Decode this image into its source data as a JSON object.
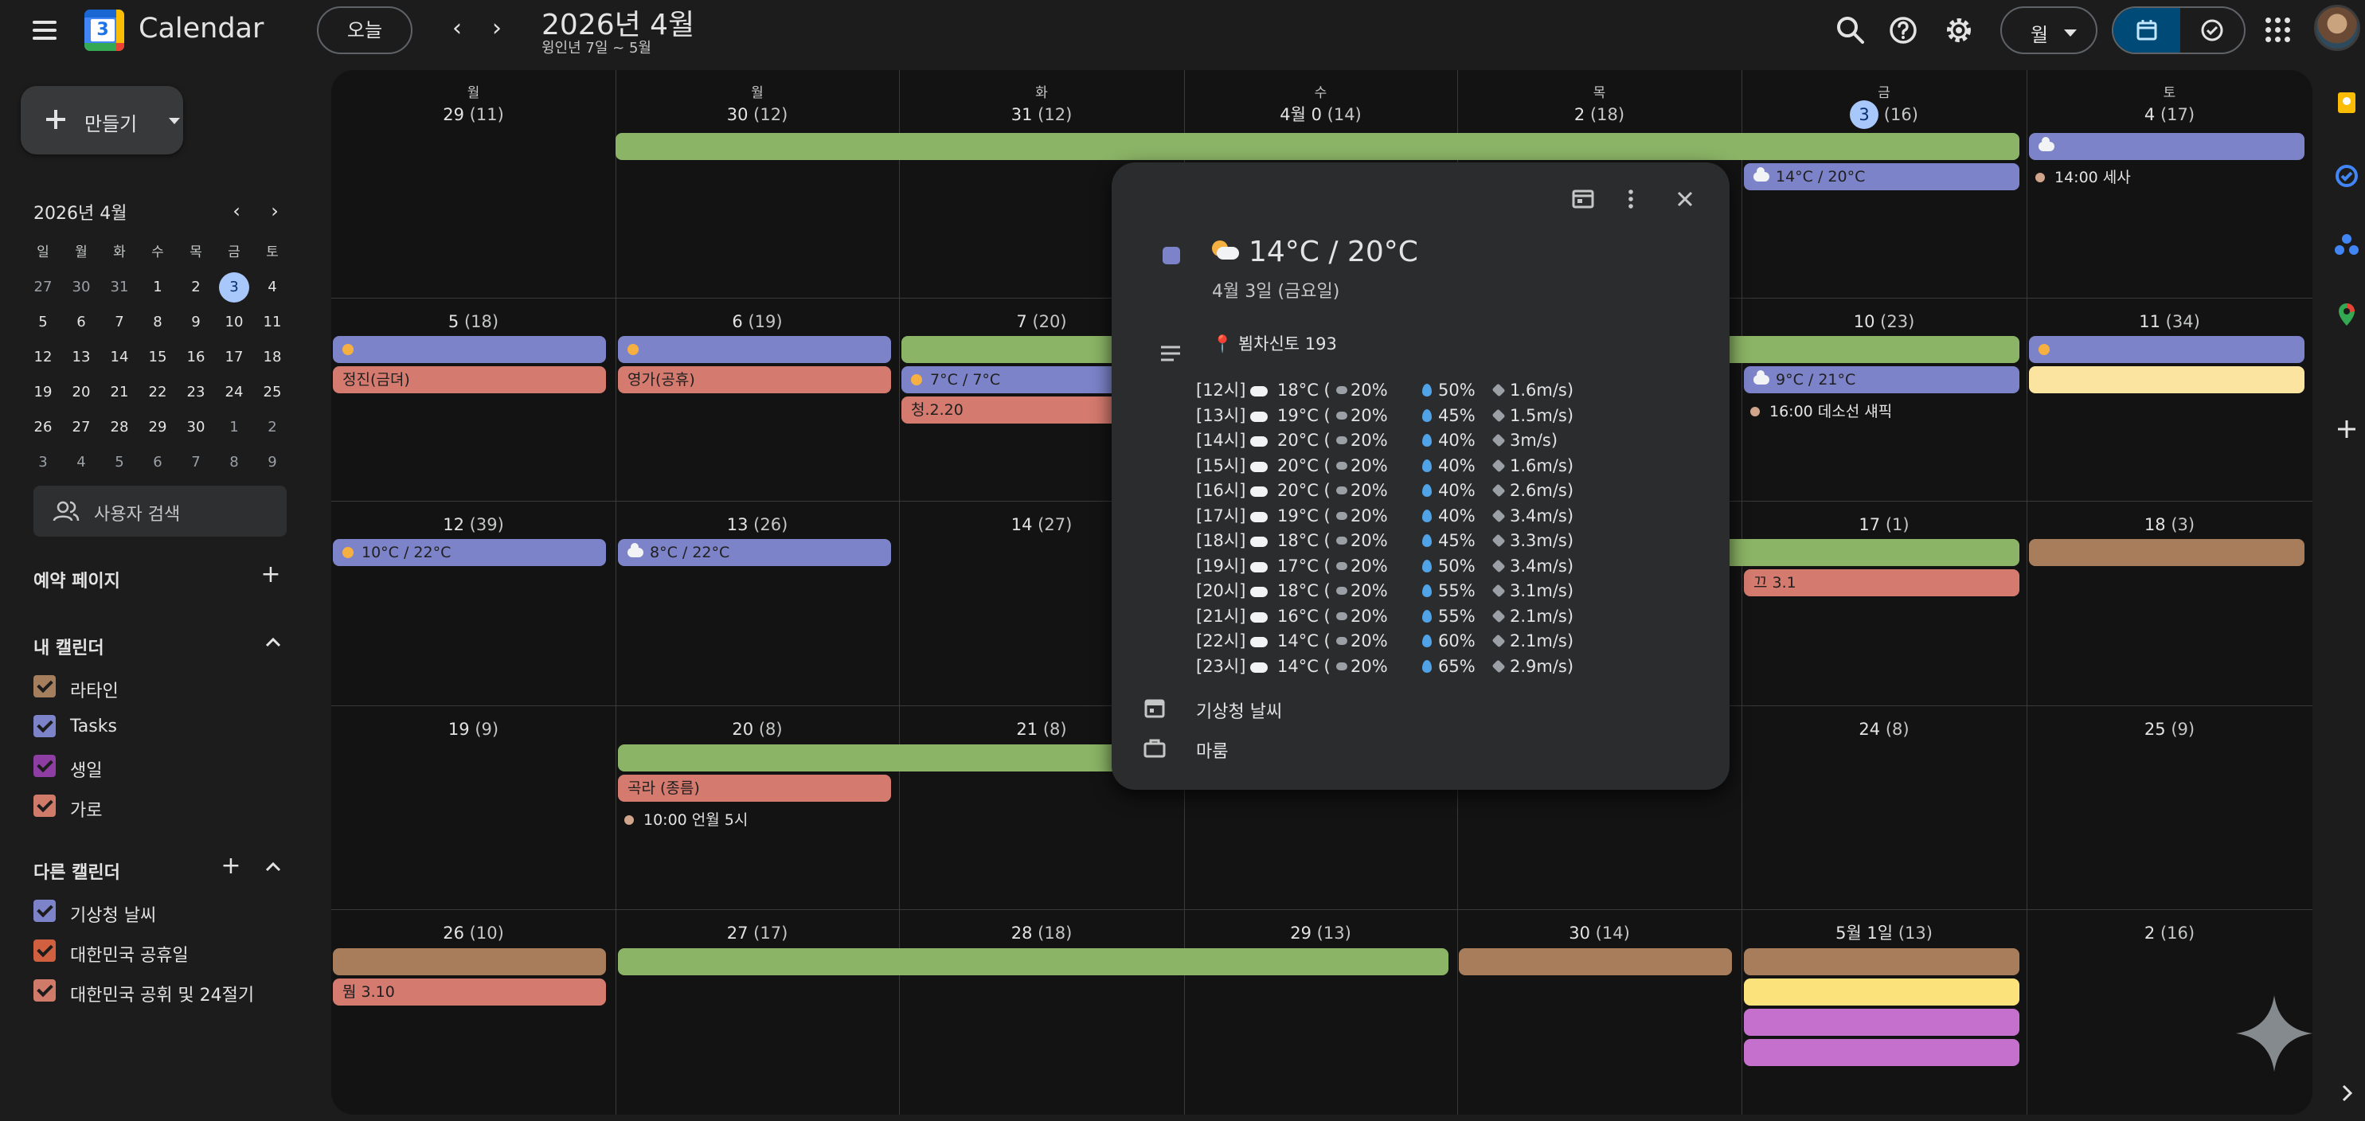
{
  "header": {
    "app_title": "Calendar",
    "logo_number": "3",
    "today_button": "오늘",
    "period_title": "2026년 4월",
    "period_sub": "윙인년 7일 ~ 5월",
    "view_label": "월",
    "icons": [
      "menu-icon",
      "search-icon",
      "help-icon",
      "settings-icon",
      "calendar-view-icon",
      "tasks-view-icon",
      "apps-icon"
    ]
  },
  "sidebar": {
    "create_label": "만들기",
    "mini_title": "2026년 4월",
    "weekday_heads": [
      "일",
      "월",
      "화",
      "수",
      "목",
      "금",
      "토"
    ],
    "mini_weeks": [
      [
        "27",
        "30",
        "31",
        "1",
        "2",
        "3",
        "4"
      ],
      [
        "5",
        "6",
        "7",
        "8",
        "9",
        "10",
        "11"
      ],
      [
        "12",
        "13",
        "14",
        "15",
        "16",
        "17",
        "18"
      ],
      [
        "19",
        "20",
        "21",
        "22",
        "23",
        "24",
        "25"
      ],
      [
        "26",
        "27",
        "28",
        "29",
        "30",
        "1",
        "2"
      ],
      [
        "3",
        "4",
        "5",
        "6",
        "7",
        "8",
        "9"
      ]
    ],
    "people_search": "사용자 검색",
    "booking_pages": "예약 페이지",
    "my_calendars_title": "내 캘린더",
    "my_calendars": [
      {
        "label": "라타인",
        "color": "#a57f5d"
      },
      {
        "label": "Tasks",
        "color": "#7c83c9"
      },
      {
        "label": "생일",
        "color": "#8e3ea3"
      },
      {
        "label": "가로",
        "color": "#d07a6a"
      }
    ],
    "other_calendars_title": "다른 캘린더",
    "other_calendars": [
      {
        "label": "기상청 날씨",
        "color": "#7c83c9"
      },
      {
        "label": "대한민국 공휴일",
        "color": "#d0603f"
      },
      {
        "label": "대한민국 공휘 및 24절기",
        "color": "#d07a6a"
      }
    ]
  },
  "grid": {
    "weekdays": [
      "월",
      "월",
      "화",
      "수",
      "목",
      "금",
      "토"
    ],
    "weeks": [
      [
        [
          "29",
          "(11)"
        ],
        [
          "30",
          "(12)"
        ],
        [
          "31",
          "(12)"
        ],
        [
          "4월 0",
          "(14)"
        ],
        [
          "2",
          "(18)"
        ],
        [
          "3",
          "(16)"
        ],
        [
          "4",
          "(17)"
        ]
      ],
      [
        [
          "5",
          "(18)"
        ],
        [
          "6",
          "(19)"
        ],
        [
          "7",
          "(20)"
        ],
        [
          "",
          ""
        ],
        [
          "",
          ""
        ],
        [
          "10",
          "(23)"
        ],
        [
          "11",
          "(34)"
        ]
      ],
      [
        [
          "12",
          "(39)"
        ],
        [
          "13",
          "(26)"
        ],
        [
          "14",
          "(27)"
        ],
        [
          "",
          ""
        ],
        [
          "",
          ""
        ],
        [
          "17",
          "(1)"
        ],
        [
          "18",
          "(3)"
        ]
      ],
      [
        [
          "19",
          "(9)"
        ],
        [
          "20",
          "(8)"
        ],
        [
          "21",
          "(8)"
        ],
        [
          "",
          ""
        ],
        [
          "",
          ""
        ],
        [
          "24",
          "(8)"
        ],
        [
          "25",
          "(9)"
        ]
      ],
      [
        [
          "26",
          "(10)"
        ],
        [
          "27",
          "(17)"
        ],
        [
          "28",
          "(18)"
        ],
        [
          "29",
          "(13)"
        ],
        [
          "30",
          "(14)"
        ],
        [
          "5월 1일",
          "(13)"
        ],
        [
          "2",
          "(16)"
        ]
      ]
    ],
    "events": {
      "w1_fri_weather": "14°C / 20°C",
      "w1_sat_item": "14:00 세사",
      "w2_mon_red": "정진(금뎌)",
      "w2_tue_red": "영가(공휴)",
      "w2_wed_weather": "7°C / 7°C",
      "w2_wed_red": "청.2.20",
      "w2_fri_weather": "9°C / 21°C",
      "w2_fri_item": "16:00 데소선 섀픽",
      "w3_mon_weather": "10°C / 22°C",
      "w3_tue_weather": "8°C / 22°C",
      "w3_fri_red": "끄 3.1",
      "w4_tue_red": "곡라 (종름)",
      "w4_tue_item": "10:00 언월 5시",
      "w5_mon_red": "뭠 3.10"
    }
  },
  "popup": {
    "title": "14°C / 20°C",
    "date": "4월 3일 (금요일)",
    "location": "📍 뵘차신토 193",
    "rows": [
      {
        "hour": "[12시]",
        "temp": "18°C (",
        "rain": "20%",
        "hum": "50%",
        "wind": "1.6m/s)"
      },
      {
        "hour": "[13시]",
        "temp": "19°C (",
        "rain": "20%",
        "hum": "45%",
        "wind": "1.5m/s)"
      },
      {
        "hour": "[14시]",
        "temp": "20°C (",
        "rain": "20%",
        "hum": "40%",
        "wind": "3m/s)"
      },
      {
        "hour": "[15시]",
        "temp": "20°C (",
        "rain": "20%",
        "hum": "40%",
        "wind": "1.6m/s)"
      },
      {
        "hour": "[16시]",
        "temp": "20°C (",
        "rain": "20%",
        "hum": "40%",
        "wind": "2.6m/s)"
      },
      {
        "hour": "[17시]",
        "temp": "19°C (",
        "rain": "20%",
        "hum": "40%",
        "wind": "3.4m/s)"
      },
      {
        "hour": "[18시]",
        "temp": "18°C (",
        "rain": "20%",
        "hum": "45%",
        "wind": "3.3m/s)"
      },
      {
        "hour": "[19시]",
        "temp": "17°C (",
        "rain": "20%",
        "hum": "50%",
        "wind": "3.4m/s)"
      },
      {
        "hour": "[20시]",
        "temp": "18°C (",
        "rain": "20%",
        "hum": "55%",
        "wind": "3.1m/s)"
      },
      {
        "hour": "[21시]",
        "temp": "16°C (",
        "rain": "20%",
        "hum": "55%",
        "wind": "2.1m/s)"
      },
      {
        "hour": "[22시]",
        "temp": "14°C (",
        "rain": "20%",
        "hum": "60%",
        "wind": "2.1m/s)"
      },
      {
        "hour": "[23시]",
        "temp": "14°C (",
        "rain": "20%",
        "hum": "65%",
        "wind": "2.9m/s)"
      }
    ],
    "calendar_name": "기상청 날씨",
    "availability": "마룸"
  },
  "colors": {
    "green": "#8bb466",
    "purple": "#7c83c9",
    "red": "#d47a6e",
    "brown": "#a77d5b",
    "yellow": "#fbe27a",
    "pale_yellow": "#fbe3a0",
    "magenta": "#c470cc"
  }
}
